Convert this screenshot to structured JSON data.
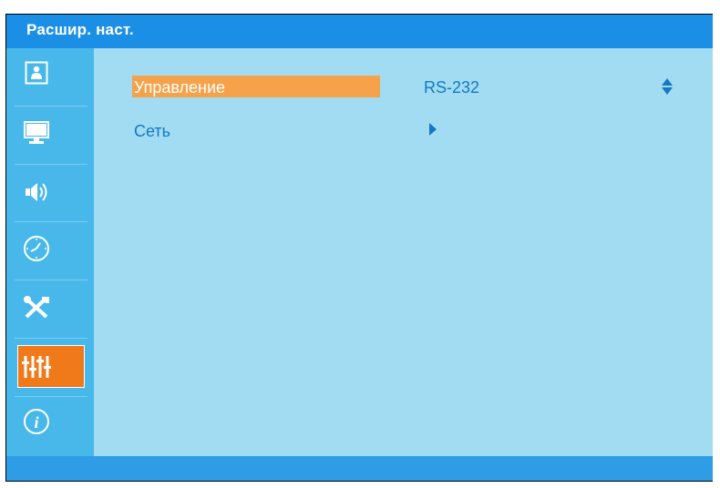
{
  "window": {
    "title": "Расшир. наст."
  },
  "sidebar": {
    "items": [
      {
        "icon": "picture-icon"
      },
      {
        "icon": "display-icon"
      },
      {
        "icon": "volume-icon"
      },
      {
        "icon": "clock-icon"
      },
      {
        "icon": "tools-icon"
      },
      {
        "icon": "sliders-icon",
        "active": true
      },
      {
        "icon": "info-icon"
      }
    ]
  },
  "menu": {
    "rows": [
      {
        "label": "Управление",
        "value": "RS-232",
        "selected": true
      },
      {
        "label": "Сеть"
      }
    ]
  },
  "colors": {
    "titlebar": "#1b8fe6",
    "sidebar": "#48b8ea",
    "content": "#a2dcf2",
    "highlight": "#f6a24a",
    "active_icon": "#f07a1a",
    "text": "#1479c4"
  }
}
